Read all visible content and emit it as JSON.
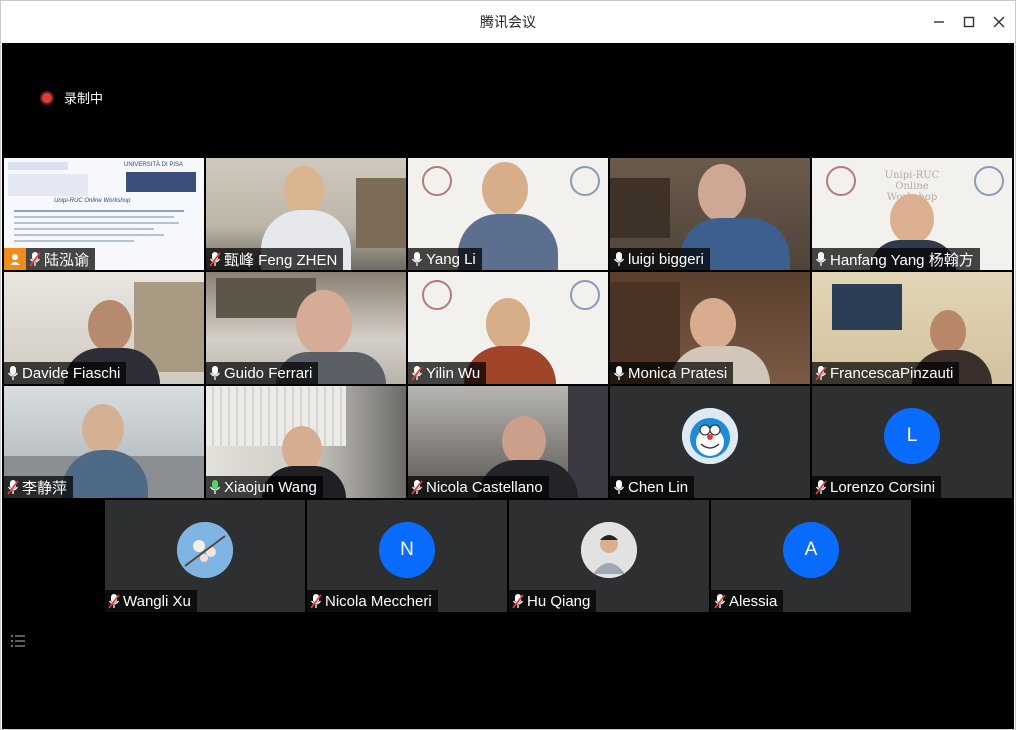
{
  "window": {
    "title": "腾讯会议"
  },
  "recording": {
    "label": "录制中"
  },
  "slide_tile": {
    "heading": "Unipi-RUC Online Workshop",
    "host_name": "陆泓谕",
    "university_label": "UNIVERSITÀ DI PISA"
  },
  "watermark": {
    "line1": "Unipi-RUC",
    "line2": "Online Workshop"
  },
  "participants": [
    {
      "name": "甄峰 Feng ZHEN",
      "muted": true
    },
    {
      "name": "Yang Li",
      "muted": false
    },
    {
      "name": "luigi biggeri",
      "muted": false
    },
    {
      "name": "Hanfang Yang 杨翰方",
      "muted": false
    },
    {
      "name": "Davide Fiaschi",
      "muted": false
    },
    {
      "name": "Guido Ferrari",
      "muted": false
    },
    {
      "name": "Yilin Wu",
      "muted": true
    },
    {
      "name": "Monica Pratesi",
      "muted": false
    },
    {
      "name": "FrancescaPinzauti",
      "muted": true
    },
    {
      "name": "李静萍",
      "muted": true
    },
    {
      "name": "Xiaojun Wang",
      "muted": false
    },
    {
      "name": "Nicola Castellano",
      "muted": true
    },
    {
      "name": "Chen Lin",
      "muted": false
    },
    {
      "name": "Lorenzo Corsini",
      "muted": true,
      "avatar_letter": "L"
    },
    {
      "name": "Wangli Xu",
      "muted": true
    },
    {
      "name": "Nicola Meccheri",
      "muted": true,
      "avatar_letter": "N"
    },
    {
      "name": "Hu Qiang",
      "muted": true
    },
    {
      "name": "Alessia",
      "muted": true,
      "avatar_letter": "A"
    }
  ],
  "colors": {
    "stage": "#000000",
    "avatar_blue": "#0a6cff",
    "host_badge": "#f08c1a",
    "recording_dot": "#e23b3b"
  }
}
